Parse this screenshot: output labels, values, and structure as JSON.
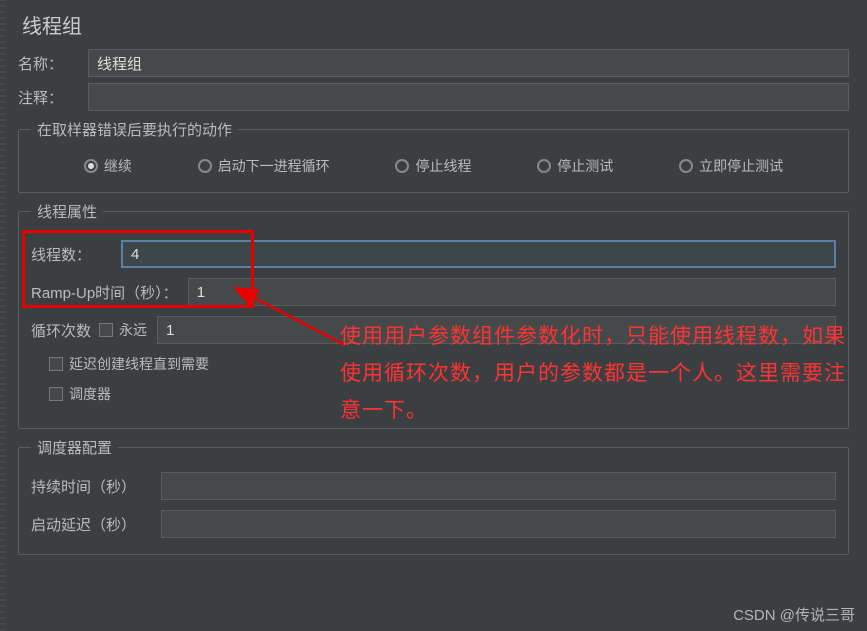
{
  "title": "线程组",
  "nameField": {
    "label": "名称：",
    "value": "线程组"
  },
  "commentField": {
    "label": "注释：",
    "value": ""
  },
  "errorAction": {
    "legend": "在取样器错误后要执行的动作",
    "options": {
      "continue": "继续",
      "nextLoop": "启动下一进程循环",
      "stopThread": "停止线程",
      "stopTest": "停止测试",
      "stopNow": "立即停止测试"
    },
    "selected": "continue"
  },
  "threadProps": {
    "legend": "线程属性",
    "threadsLabel": "线程数：",
    "threadsValue": "4",
    "rampLabel": "Ramp-Up时间（秒）：",
    "rampValue": "1",
    "loopLabel": "循环次数",
    "foreverLabel": "永远",
    "loopValue": "1",
    "delayCreateLabel": "延迟创建线程直到需要",
    "schedulerLabel": "调度器"
  },
  "schedulerConfig": {
    "legend": "调度器配置",
    "durationLabel": "持续时间（秒）",
    "durationValue": "",
    "delayLabel": "启动延迟（秒）",
    "delayValue": ""
  },
  "annotation": "使用用户参数组件参数化时，只能使用线程数，如果使用循环次数，用户的参数都是一个人。这里需要注意一下。",
  "watermark": "CSDN @传说三哥"
}
